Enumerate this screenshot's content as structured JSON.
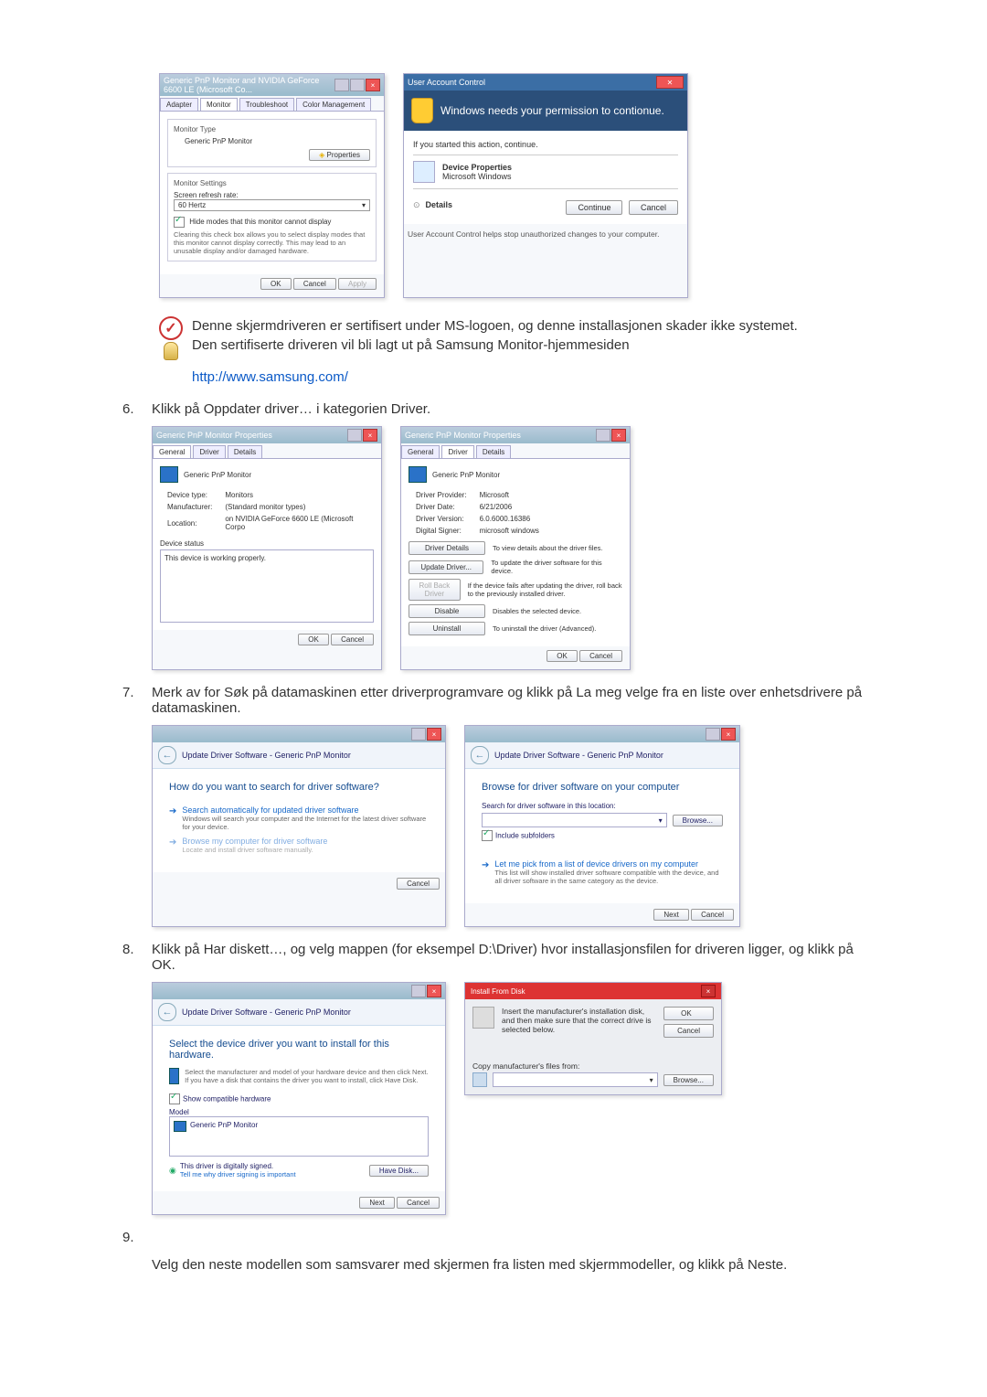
{
  "dialog1": {
    "title": "Generic PnP Monitor and NVIDIA GeForce 6600 LE (Microsoft Co...",
    "tabs": {
      "adapter": "Adapter",
      "monitor": "Monitor",
      "troubleshoot": "Troubleshoot",
      "color": "Color Management"
    },
    "monitorType": "Monitor Type",
    "monitorName": "Generic PnP Monitor",
    "propertiesBtn": "Properties",
    "settings": "Monitor Settings",
    "refreshLabel": "Screen refresh rate:",
    "refreshValue": "60 Hertz",
    "hideModes": "Hide modes that this monitor cannot display",
    "hideHint": "Clearing this check box allows you to select display modes that this monitor cannot display correctly. This may lead to an unusable display and/or damaged hardware.",
    "ok": "OK",
    "cancel": "Cancel",
    "apply": "Apply"
  },
  "uac": {
    "title": "User Account Control",
    "headline": "Windows needs your permission to contionue.",
    "started": "If you started this action, continue.",
    "item1": "Device Properties",
    "item2": "Microsoft Windows",
    "details": "Details",
    "continue": "Continue",
    "cancel": "Cancel",
    "foot": "User Account Control helps stop unauthorized changes to your computer."
  },
  "note": {
    "line1": "Denne skjermdriveren er sertifisert under MS-logoen, og denne installasjonen skader ikke systemet.",
    "line2": "Den sertifiserte driveren vil bli lagt ut på Samsung Monitor-hjemmesiden",
    "link": "http://www.samsung.com/"
  },
  "step6": {
    "num": "6.",
    "text": "Klikk på Oppdater driver… i kategorien Driver.",
    "propsA": {
      "title": "Generic PnP Monitor Properties",
      "tabs": {
        "general": "General",
        "driver": "Driver",
        "details": "Details"
      },
      "name": "Generic PnP Monitor",
      "rows": {
        "devtype_l": "Device type:",
        "devtype_v": "Monitors",
        "manu_l": "Manufacturer:",
        "manu_v": "(Standard monitor types)",
        "loc_l": "Location:",
        "loc_v": "on NVIDIA GeForce 6600 LE (Microsoft Corpo"
      },
      "statusLabel": "Device status",
      "statusText": "This device is working properly.",
      "ok": "OK",
      "cancel": "Cancel"
    },
    "propsB": {
      "title": "Generic PnP Monitor Properties",
      "name": "Generic PnP Monitor",
      "rows": {
        "prov_l": "Driver Provider:",
        "prov_v": "Microsoft",
        "date_l": "Driver Date:",
        "date_v": "6/21/2006",
        "ver_l": "Driver Version:",
        "ver_v": "6.0.6000.16386",
        "sign_l": "Digital Signer:",
        "sign_v": "microsoft windows"
      },
      "btns": {
        "details": "Driver Details",
        "details_d": "To view details about the driver files.",
        "update": "Update Driver...",
        "update_d": "To update the driver software for this device.",
        "rollback": "Roll Back Driver",
        "rollback_d": "If the device fails after updating the driver, roll back to the previously installed driver.",
        "disable": "Disable",
        "disable_d": "Disables the selected device.",
        "uninstall": "Uninstall",
        "uninstall_d": "To uninstall the driver (Advanced)."
      },
      "ok": "OK",
      "cancel": "Cancel"
    }
  },
  "step7": {
    "num": "7.",
    "text": "Merk av for Søk på datamaskinen etter driverprogramvare og klikk på La meg velge fra en liste over enhetsdrivere på datamaskinen.",
    "wizA": {
      "crumb": "Update Driver Software - Generic PnP Monitor",
      "q": "How do you want to search for driver software?",
      "opt1": "Search automatically for updated driver software",
      "opt1s": "Windows will search your computer and the Internet for the latest driver software for your device.",
      "opt2": "Browse my computer for driver software",
      "opt2s": "Locate and install driver software manually.",
      "cancel": "Cancel"
    },
    "wizB": {
      "crumb": "Update Driver Software - Generic PnP Monitor",
      "q": "Browse for driver software on your computer",
      "searchLabel": "Search for driver software in this location:",
      "browse": "Browse...",
      "include": "Include subfolders",
      "opt": "Let me pick from a list of device drivers on my computer",
      "opts": "This list will show installed driver software compatible with the device, and all driver software in the same category as the device.",
      "next": "Next",
      "cancel": "Cancel"
    }
  },
  "step8": {
    "num": "8.",
    "text": "Klikk på Har diskett…, og velg mappen (for eksempel D:\\Driver) hvor installasjonsfilen for driveren ligger, og klikk på OK.",
    "wiz": {
      "crumb": "Update Driver Software - Generic PnP Monitor",
      "q": "Select the device driver you want to install for this hardware.",
      "hint": "Select the manufacturer and model of your hardware device and then click Next. If you have a disk that contains the driver you want to install, click Have Disk.",
      "compat": "Show compatible hardware",
      "model": "Model",
      "item": "Generic PnP Monitor",
      "signed": "This driver is digitally signed.",
      "tell": "Tell me why driver signing is important",
      "havedisk": "Have Disk...",
      "next": "Next",
      "cancel": "Cancel"
    },
    "install": {
      "title": "Install From Disk",
      "msg": "Insert the manufacturer's installation disk, and then make sure that the correct drive is selected below.",
      "ok": "OK",
      "cancel": "Cancel",
      "copy": "Copy manufacturer's files from:",
      "browse": "Browse..."
    }
  },
  "step9": {
    "num": "9.",
    "text": "Velg den neste modellen som samsvarer med skjermen fra listen med skjermmodeller, og klikk på Neste."
  }
}
